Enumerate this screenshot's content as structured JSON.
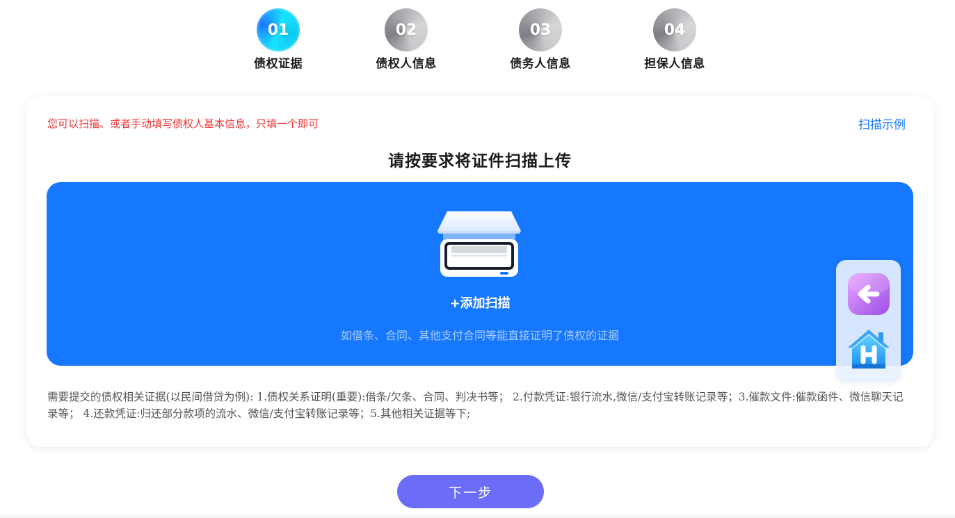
{
  "steps": [
    {
      "num": "01",
      "label": "债权证据",
      "state": "active"
    },
    {
      "num": "02",
      "label": "债权人信息",
      "state": "inactive"
    },
    {
      "num": "03",
      "label": "债务人信息",
      "state": "inactive"
    },
    {
      "num": "04",
      "label": "担保人信息",
      "state": "inactive"
    }
  ],
  "card": {
    "hint": "您可以扫描、或者手动填写债权人基本信息，只填一个即可",
    "sample_link": "扫描示例",
    "title": "请按要求将证件扫描上传",
    "upload": {
      "add_label": "+添加扫描",
      "description": "如借条、合同、其他支付合同等能直接证明了债权的证据"
    },
    "requirements": "需要提交的债权相关证据(以民间借贷为例): 1.债权关系证明(重要):借条/欠条、合同、判决书等； 2.付款凭证:银行流水,微信/支付宝转账记录等；3.催款文件:催款函件、微信聊天记录等； 4.还款凭证:归还部分款项的流水、微信/支付宝转账记录等；5.其他相关证据等下;"
  },
  "floating": {
    "back_icon": "back-arrow-icon",
    "home_icon": "home-icon"
  },
  "next_button": "下一步",
  "colors": {
    "accent_blue": "#1677ff",
    "hint_red": "#f03535",
    "next_button": "#6b6cf8"
  }
}
